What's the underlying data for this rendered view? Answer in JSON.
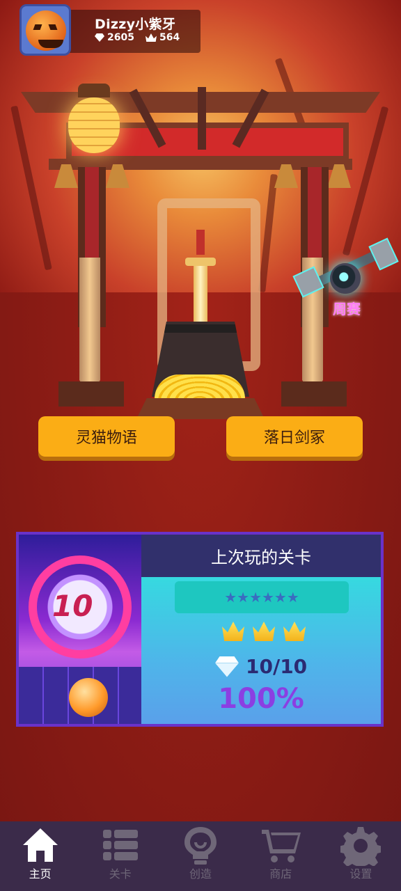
{
  "profile": {
    "username": "Dizzy小紫牙",
    "gems": "2605",
    "crowns": "564"
  },
  "weekly": {
    "label": "周赛"
  },
  "stories": [
    {
      "label": "灵猫物语"
    },
    {
      "label": "落日剑冢"
    }
  ],
  "last_played": {
    "title": "上次玩的关卡",
    "stars": "★★★★★★",
    "crowns_earned": 3,
    "gems_value": "10/10",
    "percent": "100%",
    "thumb_number": "10"
  },
  "nav": {
    "items": [
      {
        "label": "主页",
        "icon": "home-icon",
        "active": true
      },
      {
        "label": "关卡",
        "icon": "list-icon",
        "active": false
      },
      {
        "label": "创造",
        "icon": "lightbulb-icon",
        "active": false
      },
      {
        "label": "商店",
        "icon": "cart-icon",
        "active": false
      },
      {
        "label": "设置",
        "icon": "gear-icon",
        "active": false
      }
    ]
  },
  "colors": {
    "button": "#fbad15",
    "card_border": "#6a32c9",
    "percent": "#8b3fe2",
    "nav_bg": "#3b2b4a"
  }
}
